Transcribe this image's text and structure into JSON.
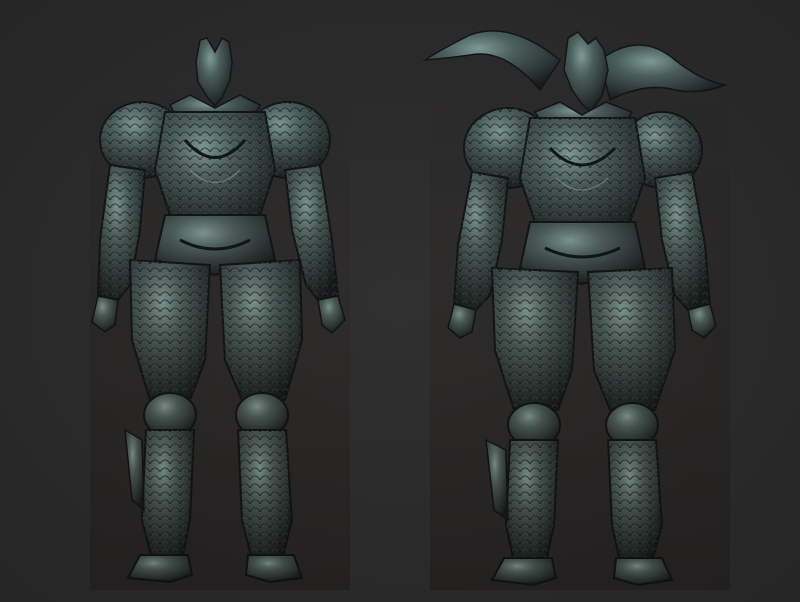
{
  "scene": {
    "background_color": "#2b2b2b",
    "material_colors": {
      "base": "#3a4a48",
      "highlight": "#7e9a96",
      "shadow": "#121616",
      "rust": "#5a3a30"
    },
    "figures": [
      {
        "name": "armored-warrior-front",
        "horns": false
      },
      {
        "name": "armored-warrior-horned",
        "horns": true
      }
    ]
  }
}
